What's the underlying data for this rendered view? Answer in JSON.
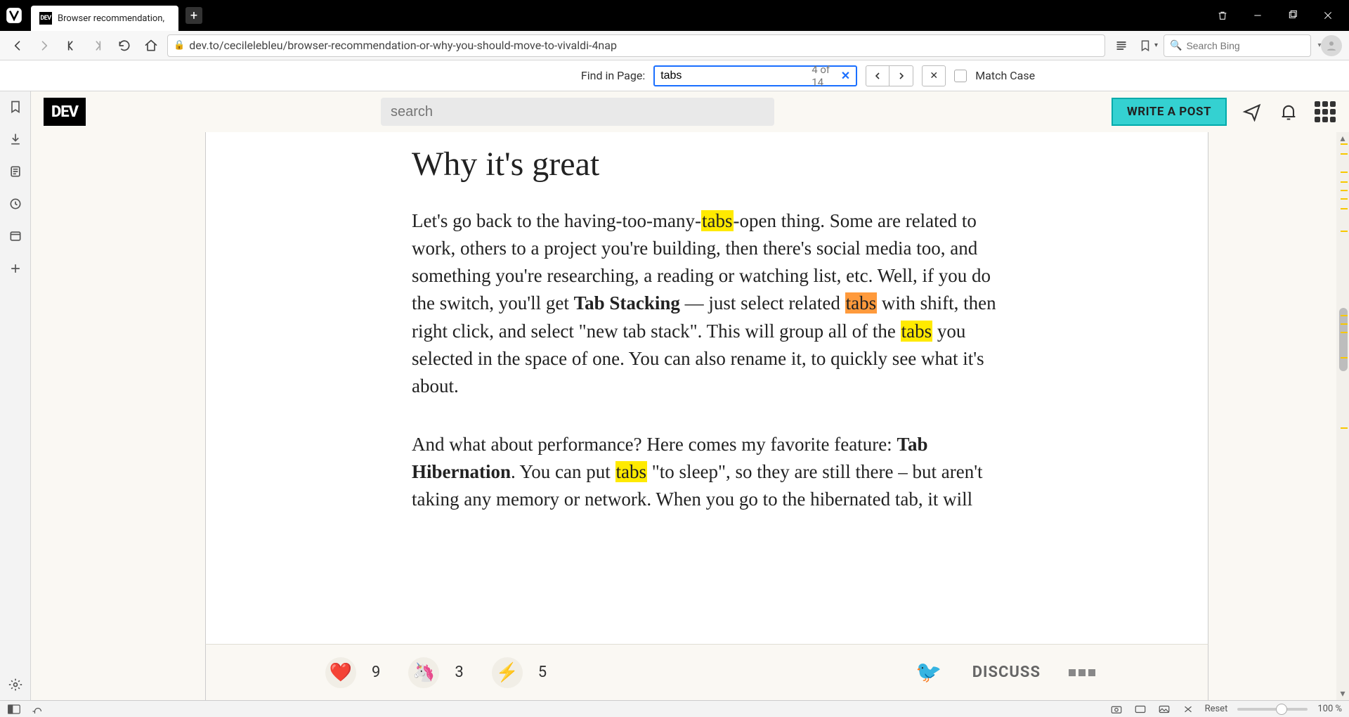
{
  "browser": {
    "tab_title": "Browser recommendation, ",
    "tab_favicon_text": "DEV",
    "url": "dev.to/cecilelebleu/browser-recommendation-or-why-you-should-move-to-vivaldi-4nap",
    "searchbox_placeholder": "Search Bing"
  },
  "find": {
    "label": "Find in Page:",
    "query": "tabs",
    "count_label": "4 of 14",
    "match_case_label": "Match Case"
  },
  "site": {
    "logo": "DEV",
    "search_placeholder": "search",
    "write_post": "WRITE A POST"
  },
  "article": {
    "heading": "Why it's great",
    "p1_a": "Let's go back to the having-too-many-",
    "p1_hl1": "tabs",
    "p1_b": "-open thing. Some are related to work, others to a project you're building, then there's social media too, and something you're researching, a reading or watching list, etc. Well, if you do the switch, you'll get ",
    "p1_strong": "Tab Stacking",
    "p1_c": " — just select related ",
    "p1_hl2": "tabs",
    "p1_d": " with shift, then right click, and select \"new tab stack\". This will group all of the ",
    "p1_hl3": "tabs",
    "p1_e": " you selected in the space of one. You can also rename it, to quickly see what it's about.",
    "p2_a": "And what about performance? Here comes my favorite feature: ",
    "p2_strong": "Tab Hibernation",
    "p2_b": ". You can put ",
    "p2_hl4": "tabs",
    "p2_c": " \"to sleep\", so they are still there – but aren't taking any memory or network. When you go to the hibernated tab, it will"
  },
  "reactions": {
    "heart": "9",
    "unicorn": "3",
    "bolt": "5",
    "discuss": "DISCUSS"
  },
  "status": {
    "reset": "Reset",
    "zoom": "100 %"
  }
}
